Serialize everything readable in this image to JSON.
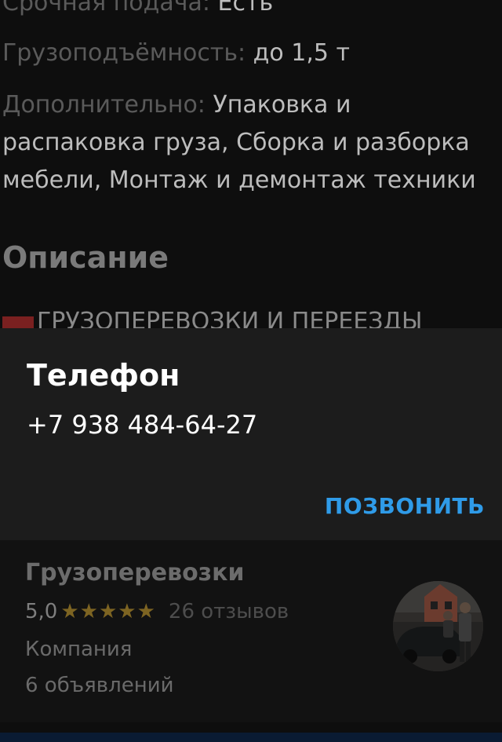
{
  "details": {
    "urgent_label": "Срочная подача:",
    "urgent_value": "Есть",
    "capacity_label": "Грузоподъёмность:",
    "capacity_value": "до 1,5 т",
    "extra_label": "Дополнительно:",
    "extra_value": "Упаковка и распаковка груза, Сборка и разборка мебели, Монтаж и демонтаж техники"
  },
  "description": {
    "title": "Описание",
    "first_line": "ГРУЗОПЕРЕВОЗКИ И ПЕРЕЕЗДЫ"
  },
  "phone_sheet": {
    "title": "Телефон",
    "number": "+7 938 484-64-27",
    "call_label": "ПОЗВОНИТЬ"
  },
  "seller": {
    "name": "Грузоперевозки",
    "rating": "5,0",
    "stars": "★★★★★",
    "reviews": "26 отзывов",
    "type": "Компания",
    "ads_count": "6 объявлений"
  },
  "colors": {
    "accent": "#2f9be8",
    "star": "#7d6422"
  }
}
